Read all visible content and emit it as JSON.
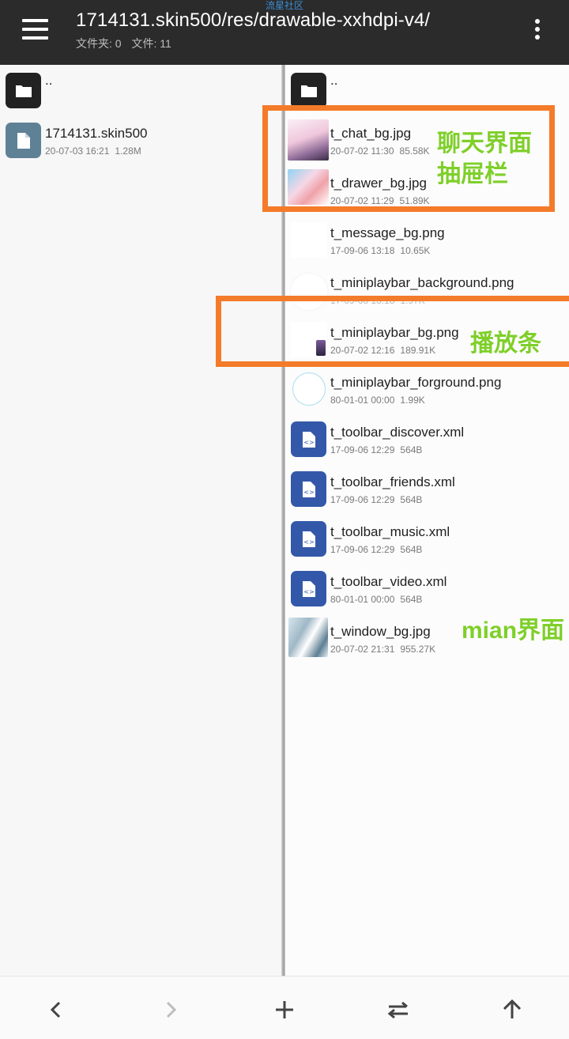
{
  "watermark": "流星社区",
  "header": {
    "path": "1714131.skin500/res/drawable-xxhdpi-v4/",
    "folders_label": "文件夹: 0",
    "files_label": "文件: 11",
    "menu_icon": "hamburger-menu-icon",
    "more_icon": "more-vert-icon"
  },
  "left_pane": {
    "parent": "..",
    "items": [
      {
        "name": "1714131.skin500",
        "date": "20-07-03 16:21",
        "size": "1.28M",
        "icon": "file-icon"
      }
    ]
  },
  "right_pane": {
    "parent": "..",
    "items": [
      {
        "name": "t_chat_bg.jpg",
        "date": "20-07-02 11:30",
        "size": "85.58K",
        "icon": "image-thumbnail"
      },
      {
        "name": "t_drawer_bg.jpg",
        "date": "20-07-02 11:29",
        "size": "51.89K",
        "icon": "image-thumbnail"
      },
      {
        "name": "t_message_bg.png",
        "date": "17-09-06 13:18",
        "size": "10.65K",
        "icon": "image-thumbnail"
      },
      {
        "name": "t_miniplaybar_background.png",
        "date": "17-09-06 13:18",
        "size": "1.97K",
        "icon": "image-thumbnail"
      },
      {
        "name": "t_miniplaybar_bg.png",
        "date": "20-07-02 12:16",
        "size": "189.91K",
        "icon": "image-thumbnail"
      },
      {
        "name": "t_miniplaybar_forground.png",
        "date": "80-01-01 00:00",
        "size": "1.99K",
        "icon": "image-thumbnail"
      },
      {
        "name": "t_toolbar_discover.xml",
        "date": "17-09-06 12:29",
        "size": "564B",
        "icon": "xml-file-icon"
      },
      {
        "name": "t_toolbar_friends.xml",
        "date": "17-09-06 12:29",
        "size": "564B",
        "icon": "xml-file-icon"
      },
      {
        "name": "t_toolbar_music.xml",
        "date": "17-09-06 12:29",
        "size": "564B",
        "icon": "xml-file-icon"
      },
      {
        "name": "t_toolbar_video.xml",
        "date": "80-01-01 00:00",
        "size": "564B",
        "icon": "xml-file-icon"
      },
      {
        "name": "t_window_bg.jpg",
        "date": "20-07-02 21:31",
        "size": "955.27K",
        "icon": "image-thumbnail"
      }
    ]
  },
  "annotations": {
    "chat_label": "聊天界面",
    "drawer_label": "抽屉栏",
    "playbar_label": "播放条",
    "main_label": "mian界面"
  },
  "bottom_nav": {
    "icons": [
      "chevron-left-icon",
      "chevron-right-icon",
      "plus-icon",
      "swap-icon",
      "arrow-up-icon"
    ]
  },
  "colors": {
    "appbar": "#2b2b2b",
    "xml_icon": "#3458a9",
    "annotation_box": "#f47b2a",
    "annotation_text": "#7fcf2a",
    "watermark": "#3d8fd6"
  }
}
